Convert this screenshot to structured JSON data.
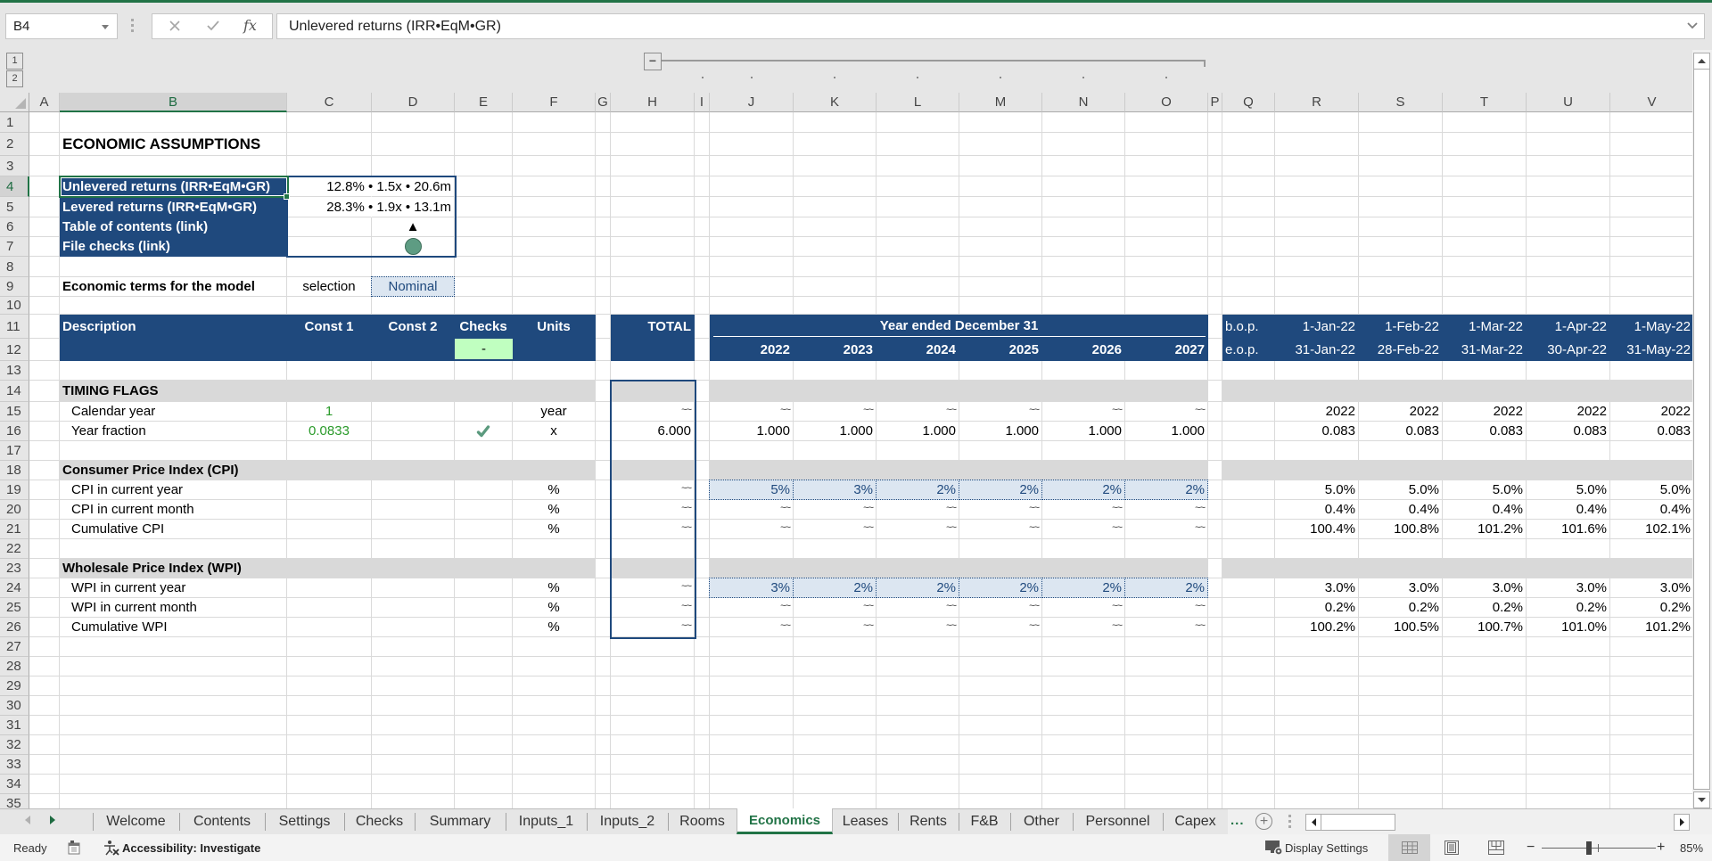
{
  "window": {
    "accent_color": "#217346"
  },
  "theme_colors": {
    "header_navy": "#1F497D",
    "section_grey": "#D9D9D9",
    "input_fill": "#DCE6F1",
    "check_ok_fill": "#C0FFC0",
    "constant_green": "#2A9A2A",
    "status_ok_circle": "#5E9C83",
    "check_mark": "#5B9A7E"
  },
  "formula_bar": {
    "name_box": "B4",
    "fx_label": "fx",
    "formula": "Unlevered returns (IRR•EqM•GR)"
  },
  "outline": {
    "levels": [
      "1",
      "2"
    ],
    "collapse_symbol": "−"
  },
  "grid": {
    "columns": [
      "A",
      "B",
      "C",
      "D",
      "E",
      "F",
      "G",
      "H",
      "I",
      "J",
      "K",
      "L",
      "M",
      "N",
      "O",
      "P",
      "Q",
      "R",
      "S",
      "T",
      "U",
      "V"
    ],
    "rows": [
      "1",
      "2",
      "3",
      "4",
      "5",
      "6",
      "7",
      "8",
      "9",
      "10",
      "11",
      "12",
      "13",
      "14",
      "15",
      "16",
      "17",
      "18",
      "19",
      "20",
      "21",
      "22",
      "23",
      "24",
      "25",
      "26",
      "27",
      "28",
      "29",
      "30",
      "31",
      "32",
      "33",
      "34",
      "35"
    ],
    "active_cell": "B4",
    "merged_cells": {
      "year_ended": "Year ended December 31"
    },
    "icons": {
      "D7": "status-ok-circle-icon",
      "E16": "check-mark-icon"
    },
    "cells": {
      "B2": "ECONOMIC ASSUMPTIONS",
      "B4": "Unlevered returns (IRR•EqM•GR)",
      "D4": "12.8% • 1.5x • 20.6m",
      "B5": "Levered returns (IRR•EqM•GR)",
      "D5": "28.3% • 1.9x • 13.1m",
      "B6": "Table of contents (link)",
      "D6": "▲",
      "B7": "File checks (link)",
      "B9": "Economic terms for the model",
      "C9": "selection",
      "D9": "Nominal",
      "B11": "Description",
      "C11": "Const 1",
      "D11": "Const 2",
      "E11": "Checks",
      "F11": "Units",
      "H11": "TOTAL",
      "Q11": "b.o.p.",
      "R11": "1-Jan-22",
      "S11": "1-Feb-22",
      "T11": "1-Mar-22",
      "U11": "1-Apr-22",
      "V11": "1-May-22",
      "E12": "-",
      "J12": "2022",
      "K12": "2023",
      "L12": "2024",
      "M12": "2025",
      "N12": "2026",
      "O12": "2027",
      "Q12": "e.o.p.",
      "R12": "31-Jan-22",
      "S12": "28-Feb-22",
      "T12": "31-Mar-22",
      "U12": "30-Apr-22",
      "V12": "31-May-22",
      "B14": "TIMING FLAGS",
      "B15": "Calendar year",
      "C15": "1",
      "F15": "year",
      "H15": "~~",
      "J15": "~~",
      "K15": "~~",
      "L15": "~~",
      "M15": "~~",
      "N15": "~~",
      "O15": "~~",
      "R15": "2022",
      "S15": "2022",
      "T15": "2022",
      "U15": "2022",
      "V15": "2022",
      "B16": "Year fraction",
      "C16": "0.0833",
      "F16": "x",
      "H16": "6.000",
      "J16": "1.000",
      "K16": "1.000",
      "L16": "1.000",
      "M16": "1.000",
      "N16": "1.000",
      "O16": "1.000",
      "R16": "0.083",
      "S16": "0.083",
      "T16": "0.083",
      "U16": "0.083",
      "V16": "0.083",
      "B18": "Consumer Price Index (CPI)",
      "B19": "CPI in current year",
      "F19": "%",
      "H19": "~~",
      "J19": "5%",
      "K19": "3%",
      "L19": "2%",
      "M19": "2%",
      "N19": "2%",
      "O19": "2%",
      "R19": "5.0%",
      "S19": "5.0%",
      "T19": "5.0%",
      "U19": "5.0%",
      "V19": "5.0%",
      "B20": "CPI in current month",
      "F20": "%",
      "H20": "~~",
      "J20": "~~",
      "K20": "~~",
      "L20": "~~",
      "M20": "~~",
      "N20": "~~",
      "O20": "~~",
      "R20": "0.4%",
      "S20": "0.4%",
      "T20": "0.4%",
      "U20": "0.4%",
      "V20": "0.4%",
      "B21": "Cumulative CPI",
      "F21": "%",
      "H21": "~~",
      "J21": "~~",
      "K21": "~~",
      "L21": "~~",
      "M21": "~~",
      "N21": "~~",
      "O21": "~~",
      "R21": "100.4%",
      "S21": "100.8%",
      "T21": "101.2%",
      "U21": "101.6%",
      "V21": "102.1%",
      "B23": "Wholesale Price Index (WPI)",
      "B24": "WPI in current year",
      "F24": "%",
      "H24": "~~",
      "J24": "3%",
      "K24": "2%",
      "L24": "2%",
      "M24": "2%",
      "N24": "2%",
      "O24": "2%",
      "R24": "3.0%",
      "S24": "3.0%",
      "T24": "3.0%",
      "U24": "3.0%",
      "V24": "3.0%",
      "B25": "WPI in current month",
      "F25": "%",
      "H25": "~~",
      "J25": "~~",
      "K25": "~~",
      "L25": "~~",
      "M25": "~~",
      "N25": "~~",
      "O25": "~~",
      "R25": "0.2%",
      "S25": "0.2%",
      "T25": "0.2%",
      "U25": "0.2%",
      "V25": "0.2%",
      "B26": "Cumulative WPI",
      "F26": "%",
      "H26": "~~",
      "J26": "~~",
      "K26": "~~",
      "L26": "~~",
      "M26": "~~",
      "N26": "~~",
      "O26": "~~",
      "R26": "100.2%",
      "S26": "100.5%",
      "T26": "100.7%",
      "U26": "101.0%",
      "V26": "101.2%"
    }
  },
  "sheet_tabs": {
    "tabs": [
      "Welcome",
      "Contents",
      "Settings",
      "Checks",
      "Summary",
      "Inputs_1",
      "Inputs_2",
      "Rooms",
      "Economics",
      "Leases",
      "Rents",
      "F&B",
      "Other",
      "Personnel",
      "Capex"
    ],
    "active_tab": "Economics",
    "more_symbol": "...",
    "add_symbol": "+"
  },
  "status_bar": {
    "mode": "Ready",
    "accessibility": "Accessibility: Investigate",
    "display_settings": "Display Settings",
    "zoom_out_symbol": "−",
    "zoom_in_symbol": "+",
    "zoom_label": "85%",
    "zoom_percent": 85
  }
}
